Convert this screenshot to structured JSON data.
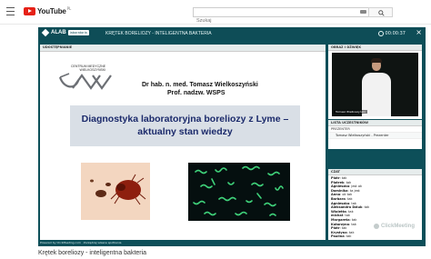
{
  "youtube": {
    "logo_text": "YouTube",
    "country": "PL",
    "search_placeholder": "Szukaj"
  },
  "player": {
    "brand": "ALAB",
    "brand_sub": "laboratoria",
    "title": "KRĘTEK BORELIOZY - INTELIGENTNA BAKTERIA",
    "time": "00:00:37",
    "main_panel_label": "UDOSTĘPNIANIE",
    "camera_label": "OBRAZ I DŹWIĘK",
    "participants_label": "LISTA UCZESTNIKÓW",
    "chat_label": "CZAT",
    "camera_name": "Tomasz Wielkoszyński",
    "presenter_group": "PREZENTER",
    "presenter_name": "Tomasz Wielkoszyński - Prezenter",
    "watermark": "ClickMeeting",
    "powered": "Powered by ClickMeeting.com · Zarządzaj własne spotkania"
  },
  "slide": {
    "logo_line1": "CENTRUM MEDYCZNE",
    "logo_line2": "WIELKOSZYŃSKI",
    "author_line1": "Dr hab. n. med. Tomasz Wielkoszyński",
    "author_line2": "Prof. nadzw. WSPS",
    "title_line1": "Diagnostyka laboratoryjna boreliozy z Lyme –",
    "title_line2": "aktualny stan wiedzy"
  },
  "chat": [
    {
      "name": "Piotr",
      "msg": "tak"
    },
    {
      "name": "Piotrek",
      "msg": "tak"
    },
    {
      "name": "Agnieszka",
      "msg": "jest ok"
    },
    {
      "name": "Dominika",
      "msg": "ta jest"
    },
    {
      "name": "Anna",
      "msg": "ok tak"
    },
    {
      "name": "Barbara",
      "msg": "tak"
    },
    {
      "name": "Agnieszka",
      "msg": "tak"
    },
    {
      "name": "Aleksandra Dziuk",
      "msg": "tak"
    },
    {
      "name": "Wioletta",
      "msg": "tak"
    },
    {
      "name": "michał",
      "msg": "tak"
    },
    {
      "name": "Margareta",
      "msg": "tak"
    },
    {
      "name": "Katarzyna",
      "msg": "tak"
    },
    {
      "name": "Piotr",
      "msg": "tak"
    },
    {
      "name": "Krystyna",
      "msg": "tak"
    },
    {
      "name": "Paulina",
      "msg": "tak"
    }
  ],
  "page_title": "Krętek boreliozy - inteligentna bakteria",
  "colors": {
    "player_bg": "#0d4f59",
    "title_box": "#d9dfe6",
    "title_text": "#1b2a6b",
    "yt_red": "#e62117"
  }
}
